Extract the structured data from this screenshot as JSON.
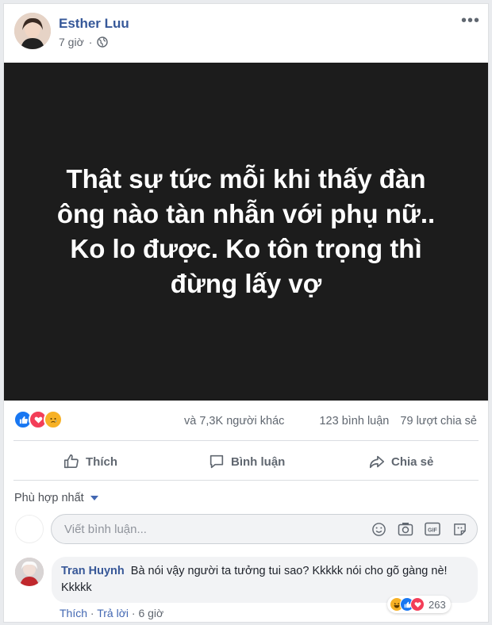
{
  "post": {
    "author": "Esther Luu",
    "time": "7 giờ",
    "privacy_icon": "globe-icon",
    "more_icon": "more-icon",
    "text": "Thật sự tức mỗi khi thấy đàn ông nào tàn nhẫn với phụ nữ.. Ko lo được. Ko tôn trọng thì đừng lấy vợ"
  },
  "reactions": {
    "types": [
      "like",
      "love",
      "sad"
    ],
    "others": "và 7,3K người khác",
    "comments": "123 bình luận",
    "shares": "79 lượt chia sẻ"
  },
  "actions": {
    "like": "Thích",
    "comment": "Bình luận",
    "share": "Chia sẻ"
  },
  "sort": {
    "label": "Phù hợp nhất"
  },
  "comment_box": {
    "placeholder": "Viết bình luận..."
  },
  "comments": [
    {
      "author": "Tran Huynh",
      "text": "Bà nói vậy người ta tưởng tui sao? Kkkkk nói cho gõ gàng nè! Kkkkk",
      "reaction_count": "263",
      "like_label": "Thích",
      "reply_label": "Trả lời",
      "time": "6 giờ"
    }
  ],
  "colors": {
    "link": "#365899",
    "image_bg": "#1c1c1c",
    "like": "#1877f2",
    "love": "#f33e58",
    "sad": "#f7b125"
  }
}
